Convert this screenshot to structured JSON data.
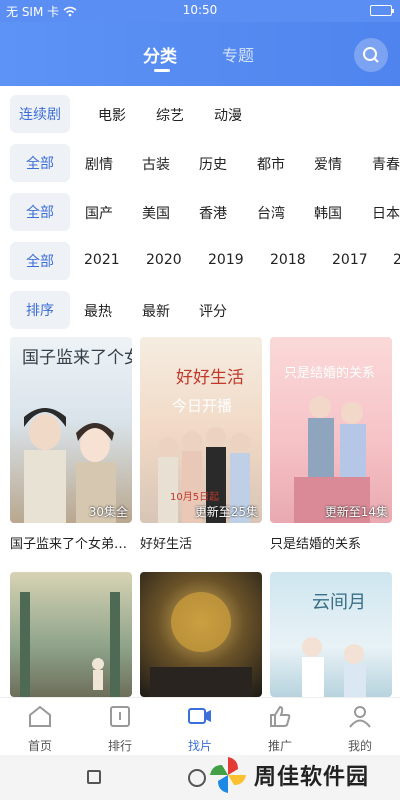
{
  "status_bar": {
    "carrier": "无 SIM 卡",
    "time": "10:50"
  },
  "header": {
    "tab_active": "分类",
    "tab_inactive": "专题"
  },
  "filters": [
    {
      "first": "连续剧",
      "options": [
        "电影",
        "综艺",
        "动漫"
      ]
    },
    {
      "first": "全部",
      "options": [
        "剧情",
        "古装",
        "历史",
        "都市",
        "爱情",
        "青春"
      ]
    },
    {
      "first": "全部",
      "options": [
        "国产",
        "美国",
        "香港",
        "台湾",
        "韩国",
        "日本"
      ]
    },
    {
      "first": "全部",
      "options": [
        "2021",
        "2020",
        "2019",
        "2018",
        "2017",
        "2"
      ]
    },
    {
      "first": "排序",
      "options": [
        "最热",
        "最新",
        "评分"
      ]
    }
  ],
  "cards": [
    {
      "title": "国子监来了个女弟…",
      "badge": "30集全",
      "poster_text": "国子监来了个女弟子"
    },
    {
      "title": "好好生活",
      "badge": "更新至25集",
      "poster_text": "好好生活",
      "poster_sub": "今日开播",
      "poster_date": "10月5日起"
    },
    {
      "title": "只是结婚的关系",
      "badge": "更新至14集",
      "poster_text": "只是结婚的关系"
    },
    {
      "title": "",
      "badge": ""
    },
    {
      "title": "",
      "badge": ""
    },
    {
      "title": "",
      "badge": "",
      "poster_text": "云间月"
    }
  ],
  "tabbar": [
    "首页",
    "排行",
    "找片",
    "推广",
    "我的"
  ],
  "watermark": "周佳软件园",
  "colors": {
    "accent": "#3d6fd8",
    "header": "#5b8ef2"
  }
}
